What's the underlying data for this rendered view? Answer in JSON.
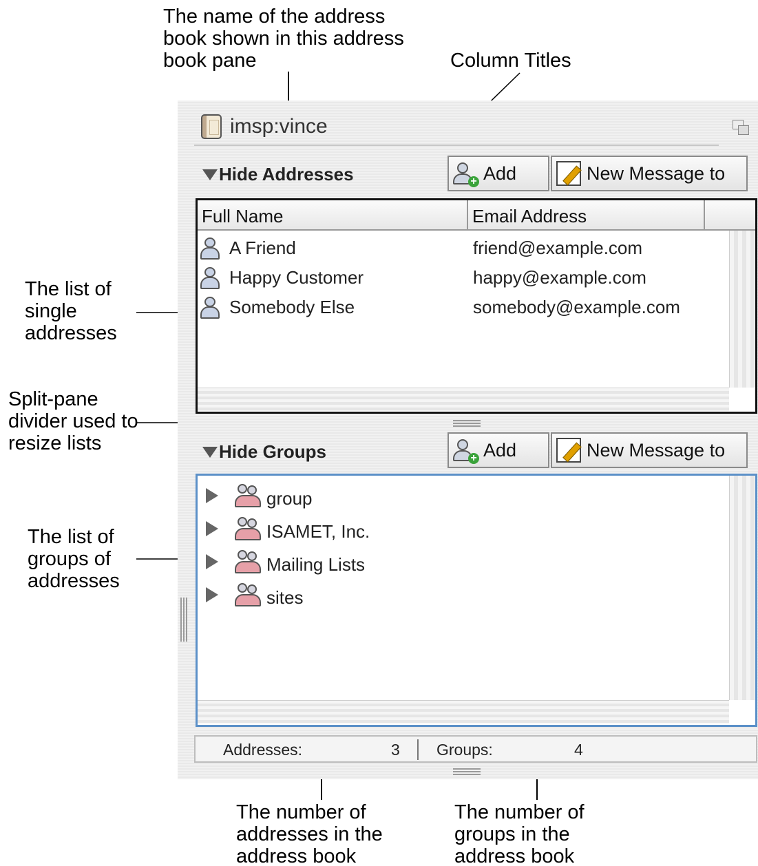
{
  "address_book": {
    "name": "imsp:vince"
  },
  "addresses_section": {
    "toggle_label": "Hide Addresses",
    "add_label": "Add",
    "new_message_label": "New Message to",
    "columns": [
      "Full Name",
      "Email Address"
    ],
    "rows": [
      {
        "name": "A Friend",
        "email": "friend@example.com"
      },
      {
        "name": "Happy Customer",
        "email": "happy@example.com"
      },
      {
        "name": "Somebody Else",
        "email": "somebody@example.com"
      }
    ]
  },
  "groups_section": {
    "toggle_label": "Hide Groups",
    "add_label": "Add",
    "new_message_label": "New Message to",
    "groups": [
      "group",
      "ISAMET, Inc.",
      "Mailing Lists",
      "sites"
    ]
  },
  "status_bar": {
    "addresses_label": "Addresses:",
    "addresses_count": "3",
    "groups_label": "Groups:",
    "groups_count": "4"
  },
  "callouts": {
    "book_name": "The name of the address book shown in this address book pane",
    "column_titles": "Column Titles",
    "single_addresses": "The list of single addresses",
    "split_divider": "Split-pane divider used to resize lists",
    "groups_list": "The list of groups of addresses",
    "addresses_count": "The number of addresses in the address book",
    "groups_count": "The number of groups in the address book"
  },
  "icons": {
    "book": "address-book-icon",
    "collapse": "collapse-pane-icon",
    "person": "person-icon",
    "add_person": "add-person-icon",
    "add_group": "add-group-icon",
    "compose": "pencil-icon",
    "group": "group-icon",
    "disclosure": "disclosure-triangle-icon",
    "expanded": "triangle-down-icon"
  }
}
